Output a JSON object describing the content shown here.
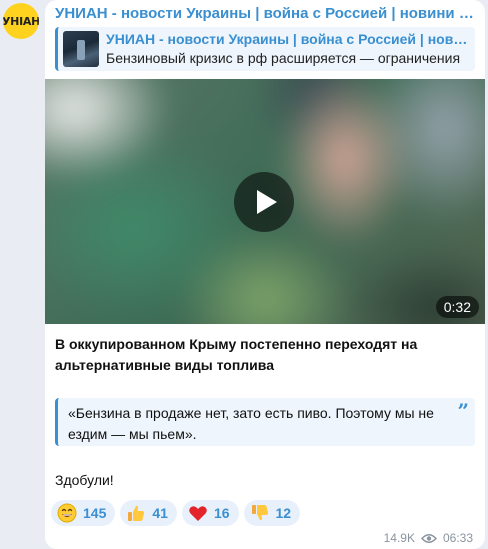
{
  "channel": {
    "avatar_text": "УНІАН",
    "name": "УНИАН - новости Украины | война с Россией | новини України"
  },
  "reply": {
    "title": "УНИАН - новости Украины | война с Россией | новини України",
    "text": "Бензиновый кризис в рф расширяется — ограничения"
  },
  "video": {
    "duration": "0:32"
  },
  "post": {
    "headline": "В оккупированном Крыму постепенно переходят на альтернативные виды топлива",
    "quote": "«Бензина в продаже нет, зато есть пиво. Поэтому мы не ездим — мы пьем».",
    "quote_mark": "”",
    "text": "Здобули!"
  },
  "reactions": [
    {
      "icon": "grinning-face-icon",
      "count": "145"
    },
    {
      "icon": "thumbs-up-icon",
      "count": "41"
    },
    {
      "icon": "red-heart-icon",
      "count": "16"
    },
    {
      "icon": "thumbs-down-icon",
      "count": "12"
    }
  ],
  "meta": {
    "views": "14.9K",
    "time": "06:33"
  },
  "colors": {
    "accent": "#3a8fd0",
    "background": "#e9edf3",
    "bubble": "#ffffff",
    "avatar": "#ffd21f"
  }
}
